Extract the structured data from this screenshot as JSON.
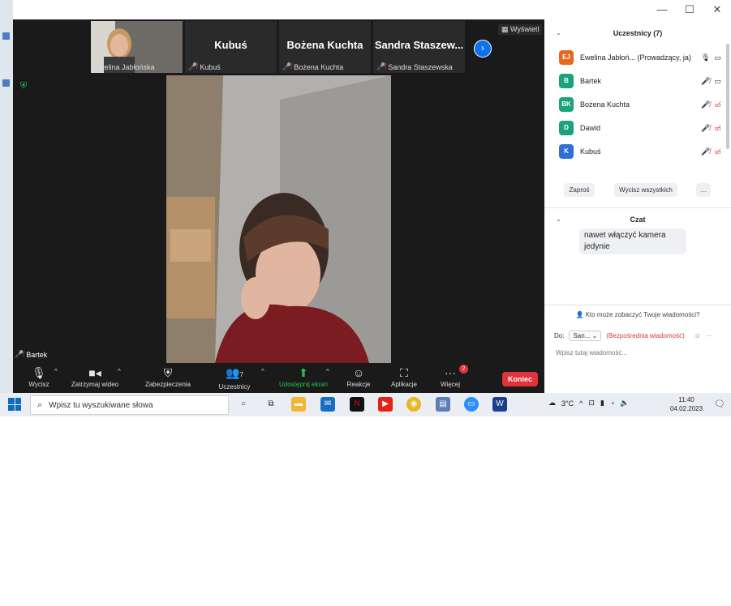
{
  "window": {
    "minimize": "—",
    "maximize": "☐",
    "close": "✕"
  },
  "thumbnails": [
    {
      "big": "",
      "label": "Ewelina Jabłońska",
      "has_video": true,
      "muted": false
    },
    {
      "big": "Kubuś",
      "label": "Kubuś",
      "muted": true
    },
    {
      "big": "Bożena Kuchta",
      "label": "Bożena Kuchta",
      "muted": true
    },
    {
      "big": "Sandra  Staszew...",
      "label": "Sandra Staszewska",
      "muted": true
    }
  ],
  "view_button": "Wyświetl",
  "speaker_label": "Bartek",
  "toolbar": {
    "mute": "Wycisz",
    "video": "Zatrzymaj wideo",
    "security": "Zabezpieczenia",
    "participants": "Uczestnicy",
    "participants_count": "7",
    "share": "Udostępnij ekran",
    "reactions": "Reakcje",
    "apps": "Aplikacje",
    "more": "Więcej",
    "more_badge": "2",
    "end": "Koniec"
  },
  "panel": {
    "participants_title": "Uczestnicy (7)",
    "participants": [
      {
        "initials": "EJ",
        "name": "Ewelina Jabłoń...  (Prowadzący, ja)",
        "color": "#e8681c"
      },
      {
        "initials": "B",
        "name": "Bartek",
        "color": "#1aa37a"
      },
      {
        "initials": "BK",
        "name": "Bożena Kuchta",
        "color": "#1aa37a"
      },
      {
        "initials": "D",
        "name": "Dawid",
        "color": "#1aa37a"
      },
      {
        "initials": "K",
        "name": "Kubuś",
        "color": "#2d6fd6"
      }
    ],
    "invite": "Zaproś",
    "mute_all": "Wycisz wszystkich",
    "more": "...",
    "chat_title": "Czat",
    "chat_message": "nawet włączyć kamera jedynie",
    "who_can_see": "Kto może zobaczyć Twoje wiadomości?",
    "to_label": "Do:",
    "to_value": "San...",
    "to_note": "(Bezpośrednia wiadomość)",
    "input_placeholder": "Wpisz tutaj wiadomość..."
  },
  "taskbar": {
    "search_placeholder": "Wpisz tu wyszukiwane słowa",
    "temperature": "3°C",
    "time": "11:40",
    "date": "04.02.2023"
  }
}
